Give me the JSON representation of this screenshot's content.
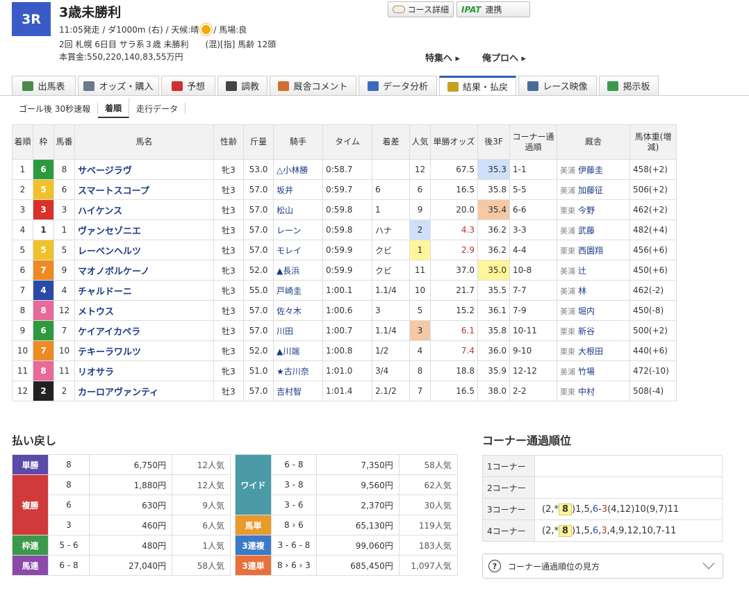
{
  "header": {
    "race_no": "3R",
    "race_name": "3歳未勝利",
    "info_time": "11:05発走 / ダ1000m (右) / 天候:晴",
    "info_track": "/ 馬場:良",
    "info_line2": "2回 札幌 6日目 サラ系３歳 未勝利　　(混)[指] 馬齢 12頭",
    "prize": "本賞金:550,220,140,83,55万円",
    "course_btn": "コース詳細",
    "ipat_logo": "IPAT",
    "ipat_label": "連携",
    "link_special": "特集へ ▸",
    "link_pro": "俺プロへ ▸"
  },
  "tabs": [
    {
      "label": "出馬表",
      "color": "#4a8a4a"
    },
    {
      "label": "オッズ・購入",
      "color": "#6a7a8a"
    },
    {
      "label": "予想",
      "color": "#d03030"
    },
    {
      "label": "調教",
      "color": "#444444"
    },
    {
      "label": "厩舎コメント",
      "color": "#d07030"
    },
    {
      "label": "データ分析",
      "color": "#3a6ac0"
    },
    {
      "label": "結果・払戻",
      "color": "#c8a020"
    },
    {
      "label": "レース映像",
      "color": "#4a6a9a"
    },
    {
      "label": "掲示板",
      "color": "#3a9a4a"
    }
  ],
  "subtabs": [
    "ゴール後 30秒速報",
    "着順",
    "走行データ"
  ],
  "table_headers": [
    "着順",
    "枠",
    "馬番",
    "馬名",
    "性齢",
    "斤量",
    "騎手",
    "タイム",
    "着差",
    "人気",
    "単勝オッズ",
    "後3F",
    "コーナー通過順",
    "厩舎",
    "馬体重(増減)"
  ],
  "rows": [
    {
      "pos": "1",
      "waku": "6",
      "num": "8",
      "name": "サベージラヴ",
      "sex": "牝3",
      "kin": "53.0",
      "jockey": "△小林勝",
      "time": "0:58.7",
      "diff": "",
      "pop": "12",
      "odds": "67.5",
      "f3": "35.3",
      "corner": "1-1",
      "region": "美浦",
      "trainer": "伊藤圭",
      "weight": "458(+2)"
    },
    {
      "pos": "2",
      "waku": "5",
      "num": "6",
      "name": "スマートスコープ",
      "sex": "牡3",
      "kin": "57.0",
      "jockey": "坂井",
      "time": "0:59.7",
      "diff": "6",
      "pop": "6",
      "odds": "16.5",
      "f3": "35.8",
      "corner": "5-5",
      "region": "美浦",
      "trainer": "加藤征",
      "weight": "506(+2)"
    },
    {
      "pos": "3",
      "waku": "3",
      "num": "3",
      "name": "ハイケンス",
      "sex": "牡3",
      "kin": "57.0",
      "jockey": "松山",
      "time": "0:59.8",
      "diff": "1",
      "pop": "9",
      "odds": "20.0",
      "f3": "35.4",
      "corner": "6-6",
      "region": "栗東",
      "trainer": "今野",
      "weight": "462(+2)"
    },
    {
      "pos": "4",
      "waku": "1",
      "num": "1",
      "name": "ヴァンセゾニエ",
      "sex": "牡3",
      "kin": "57.0",
      "jockey": "レーン",
      "time": "0:59.8",
      "diff": "ハナ",
      "pop": "2",
      "odds": "4.3",
      "f3": "36.2",
      "corner": "3-3",
      "region": "美浦",
      "trainer": "武藤",
      "weight": "482(+4)"
    },
    {
      "pos": "5",
      "waku": "5",
      "num": "5",
      "name": "レーベンヘルツ",
      "sex": "牡3",
      "kin": "57.0",
      "jockey": "モレイ",
      "time": "0:59.9",
      "diff": "クビ",
      "pop": "1",
      "odds": "2.9",
      "f3": "36.2",
      "corner": "4-4",
      "region": "栗東",
      "trainer": "西園翔",
      "weight": "456(+6)"
    },
    {
      "pos": "6",
      "waku": "7",
      "num": "9",
      "name": "マオノボルケーノ",
      "sex": "牝3",
      "kin": "52.0",
      "jockey": "▲長浜",
      "time": "0:59.9",
      "diff": "クビ",
      "pop": "11",
      "odds": "37.0",
      "f3": "35.0",
      "corner": "10-8",
      "region": "美浦",
      "trainer": "辻",
      "weight": "450(+6)"
    },
    {
      "pos": "7",
      "waku": "4",
      "num": "4",
      "name": "チャルドーニ",
      "sex": "牝3",
      "kin": "55.0",
      "jockey": "戸崎圭",
      "time": "1:00.1",
      "diff": "1.1/4",
      "pop": "10",
      "odds": "21.7",
      "f3": "35.5",
      "corner": "7-7",
      "region": "美浦",
      "trainer": "林",
      "weight": "462(-2)"
    },
    {
      "pos": "8",
      "waku": "8",
      "num": "12",
      "name": "メトウス",
      "sex": "牡3",
      "kin": "57.0",
      "jockey": "佐々木",
      "time": "1:00.6",
      "diff": "3",
      "pop": "5",
      "odds": "15.2",
      "f3": "36.1",
      "corner": "7-9",
      "region": "美浦",
      "trainer": "堀内",
      "weight": "450(-8)"
    },
    {
      "pos": "9",
      "waku": "6",
      "num": "7",
      "name": "ケイアイカペラ",
      "sex": "牡3",
      "kin": "57.0",
      "jockey": "川田",
      "time": "1:00.7",
      "diff": "1.1/4",
      "pop": "3",
      "odds": "6.1",
      "f3": "35.8",
      "corner": "10-11",
      "region": "栗東",
      "trainer": "新谷",
      "weight": "500(+2)"
    },
    {
      "pos": "10",
      "waku": "7",
      "num": "10",
      "name": "テキーラワルツ",
      "sex": "牝3",
      "kin": "52.0",
      "jockey": "▲川端",
      "time": "1:00.8",
      "diff": "1/2",
      "pop": "4",
      "odds": "7.4",
      "f3": "36.0",
      "corner": "9-10",
      "region": "栗東",
      "trainer": "大根田",
      "weight": "440(+6)"
    },
    {
      "pos": "11",
      "waku": "8",
      "num": "11",
      "name": "リオサラ",
      "sex": "牝3",
      "kin": "51.0",
      "jockey": "★古川奈",
      "time": "1:01.0",
      "diff": "3/4",
      "pop": "8",
      "odds": "18.8",
      "f3": "35.9",
      "corner": "12-12",
      "region": "美浦",
      "trainer": "竹場",
      "weight": "472(-10)"
    },
    {
      "pos": "12",
      "waku": "2",
      "num": "2",
      "name": "カーロアヴァンティ",
      "sex": "牡3",
      "kin": "57.0",
      "jockey": "吉村智",
      "time": "1:01.4",
      "diff": "2.1/2",
      "pop": "7",
      "odds": "16.5",
      "f3": "38.0",
      "corner": "2-2",
      "region": "栗東",
      "trainer": "中村",
      "weight": "508(-4)"
    }
  ],
  "waku_colors": {
    "1": "#ffffff",
    "2": "#222222",
    "3": "#d8302a",
    "4": "#2a4aa8",
    "5": "#f1c12a",
    "6": "#2e9a3e",
    "7": "#ee8a22",
    "8": "#e86a9a"
  },
  "payout_title": "払い戻し",
  "payout_left": [
    {
      "label": "単勝",
      "color": "#5b4aa8",
      "lines": [
        {
          "num": "8",
          "amt": "6,750円",
          "pop": "12人気"
        }
      ]
    },
    {
      "label": "複勝",
      "color": "#d03a3a",
      "lines": [
        {
          "num": "8",
          "amt": "1,880円",
          "pop": "12人気"
        },
        {
          "num": "6",
          "amt": "630円",
          "pop": "9人気"
        },
        {
          "num": "3",
          "amt": "460円",
          "pop": "6人気"
        }
      ]
    },
    {
      "label": "枠連",
      "color": "#3a9a4a",
      "lines": [
        {
          "num": "5 - 6",
          "amt": "480円",
          "pop": "1人気"
        }
      ]
    },
    {
      "label": "馬連",
      "color": "#8a4aa8",
      "lines": [
        {
          "num": "6 - 8",
          "amt": "27,040円",
          "pop": "58人気"
        }
      ]
    }
  ],
  "payout_right": [
    {
      "label": "ワイド",
      "color": "#4a9aa8",
      "lines": [
        {
          "num": "6 - 8",
          "amt": "7,350円",
          "pop": "58人気"
        },
        {
          "num": "3 - 8",
          "amt": "9,560円",
          "pop": "62人気"
        },
        {
          "num": "3 - 6",
          "amt": "2,370円",
          "pop": "30人気"
        }
      ]
    },
    {
      "label": "馬単",
      "color": "#e89a2a",
      "lines": [
        {
          "num": "8 › 6",
          "amt": "65,130円",
          "pop": "119人気"
        }
      ]
    },
    {
      "label": "3連複",
      "color": "#3a7ac8",
      "lines": [
        {
          "num": "3 - 6 - 8",
          "amt": "99,060円",
          "pop": "183人気"
        }
      ]
    },
    {
      "label": "3連単",
      "color": "#e8703a",
      "lines": [
        {
          "num": "8 › 6 › 3",
          "amt": "685,450円",
          "pop": "1,097人気"
        }
      ]
    }
  ],
  "corner_title": "コーナー通過順位",
  "corners": [
    {
      "label": "1コーナー",
      "value": ""
    },
    {
      "label": "2コーナー",
      "value": ""
    },
    {
      "label": "3コーナー",
      "value": "(2,*[8])1,5,6-3(4,12)10(9,7)11"
    },
    {
      "label": "4コーナー",
      "value": "(2,*[8])1,5,6,3,4,9,12,10,7-11"
    }
  ],
  "howto_label": "コーナー通過順位の見方"
}
